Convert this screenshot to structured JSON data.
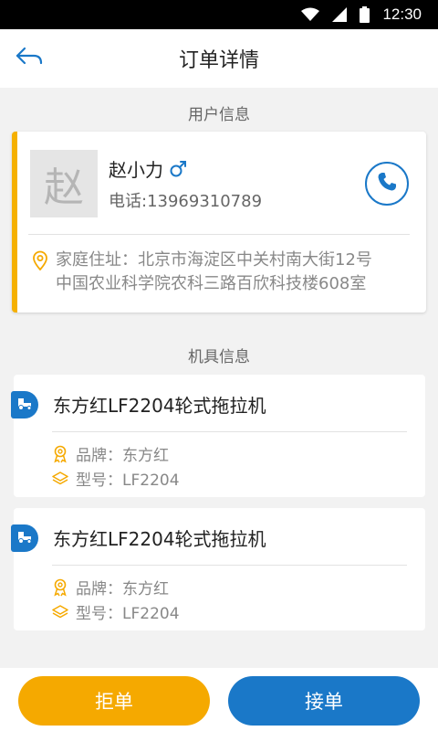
{
  "status_bar": {
    "time": "12:30"
  },
  "header": {
    "title": "订单详情"
  },
  "user_section": {
    "title": "用户信息",
    "avatar_char": "赵",
    "name": "赵小力",
    "phone": "电话:13969310789",
    "address_line1": "家庭住址：北京市海淀区中关村南大街12号",
    "address_line2": "中国农业科学院农科三路百欣科技楼608室"
  },
  "machine_section": {
    "title": "机具信息",
    "items": [
      {
        "name": "东方红LF2204轮式拖拉机",
        "brand": "品牌：东方红",
        "model": "型号：LF2204"
      },
      {
        "name": "东方红LF2204轮式拖拉机",
        "brand": "品牌：东方红",
        "model": "型号：LF2204"
      }
    ]
  },
  "actions": {
    "reject_label": "拒单",
    "accept_label": "接单"
  },
  "colors": {
    "primary": "#1a78c8",
    "accent": "#f5a900",
    "background": "#f2f2f2"
  },
  "icons": [
    "wifi-icon",
    "signal-icon",
    "battery-icon",
    "back-arrow-icon",
    "male-icon",
    "phone-icon",
    "location-icon",
    "tractor-icon",
    "brand-icon",
    "layers-icon"
  ]
}
